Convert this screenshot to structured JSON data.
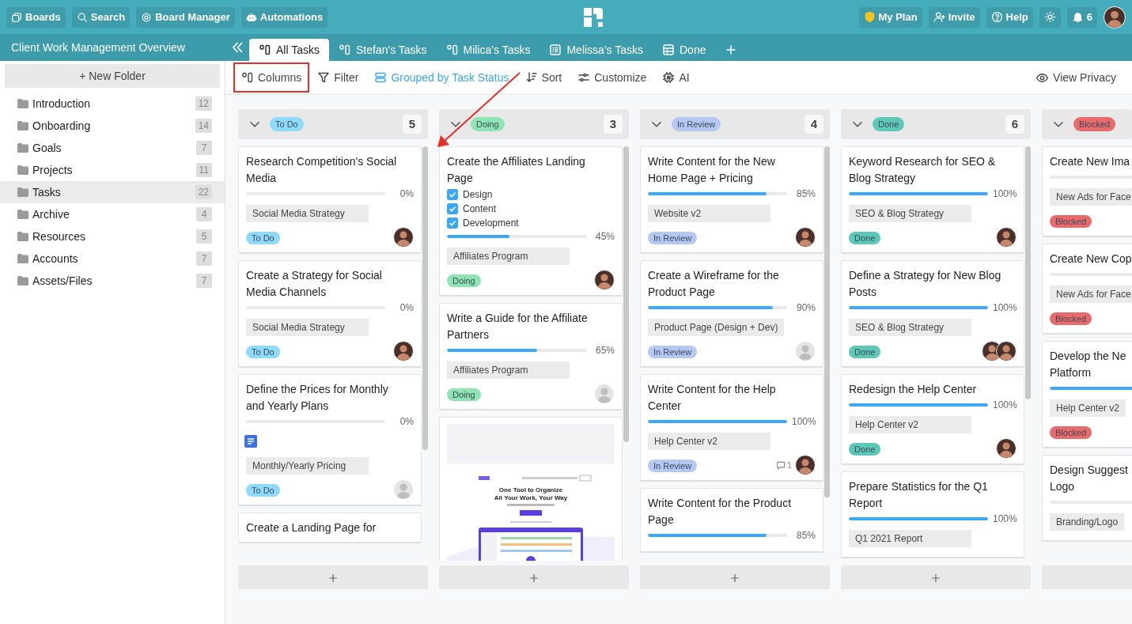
{
  "top_bar": {
    "left_buttons": [
      {
        "label": "Boards",
        "kind": "boards"
      },
      {
        "label": "Search",
        "kind": "search"
      },
      {
        "label": "Board Manager",
        "kind": "gear"
      },
      {
        "label": "Automations",
        "kind": "robot"
      }
    ],
    "right_buttons": [
      {
        "label": "My Plan",
        "kind": "shield"
      },
      {
        "label": "Invite",
        "kind": "user-plus"
      },
      {
        "label": "Help",
        "kind": "help"
      },
      {
        "kind": "sun"
      },
      {
        "label": "6",
        "kind": "bell"
      }
    ]
  },
  "project_title": "Client Work Management Overview",
  "tabs": [
    {
      "label": "All Tasks",
      "kind": "columns",
      "selected": true
    },
    {
      "label": "Stefan's Tasks",
      "kind": "columns",
      "selected": false
    },
    {
      "label": "Milica's Tasks",
      "kind": "columns",
      "selected": false
    },
    {
      "label": "Melissa's Tasks",
      "kind": "list",
      "selected": false
    },
    {
      "label": "Done",
      "kind": "table",
      "selected": false
    }
  ],
  "sidebar": {
    "new_folder": "+ New Folder",
    "items": [
      {
        "label": "Introduction",
        "count": "12",
        "selected": false
      },
      {
        "label": "Onboarding",
        "count": "14",
        "selected": false
      },
      {
        "label": "Goals",
        "count": "7",
        "selected": false
      },
      {
        "label": "Projects",
        "count": "11",
        "selected": false
      },
      {
        "label": "Tasks",
        "count": "22",
        "selected": true
      },
      {
        "label": "Archive",
        "count": "4",
        "selected": false
      },
      {
        "label": "Resources",
        "count": "5",
        "selected": false
      },
      {
        "label": "Accounts",
        "count": "7",
        "selected": false
      },
      {
        "label": "Assets/Files",
        "count": "7",
        "selected": false
      }
    ]
  },
  "toolbar": {
    "items": [
      {
        "label": "Columns",
        "kind": "columns",
        "active": false,
        "highlighted": true
      },
      {
        "label": "Filter",
        "kind": "filter",
        "active": false,
        "highlighted": false
      },
      {
        "label": "Grouped by Task Status",
        "kind": "rows",
        "active": true,
        "highlighted": false
      },
      {
        "label": "Sort",
        "kind": "sort",
        "active": false,
        "highlighted": false
      },
      {
        "label": "Customize",
        "kind": "sliders",
        "active": false,
        "highlighted": false
      },
      {
        "label": "AI",
        "kind": "chip",
        "active": false,
        "highlighted": false
      }
    ],
    "view_privacy": "View Privacy"
  },
  "annotations": [
    {
      "kind": "arrow"
    }
  ],
  "columns": [
    {
      "status": "To Do",
      "color": "#8fd9fb",
      "count": "5",
      "cards": [
        {
          "kind": "task",
          "title": "Research Competition's Social Media",
          "level": 0,
          "percent": "0%",
          "tag": "Social Media Strategy",
          "status": "To Do",
          "avatars": [
            {
              "kind": "photo"
            }
          ]
        },
        {
          "kind": "task",
          "title": "Create a Strategy for Social Media Channels",
          "level": 0,
          "percent": "0%",
          "tag": "Social Media Strategy",
          "status": "To Do",
          "avatars": [
            {
              "kind": "photo"
            }
          ]
        },
        {
          "kind": "task",
          "title": "Define the Prices for Monthly and Yearly Plans",
          "level": 0,
          "percent": "0%",
          "has_document": true,
          "tag": "Monthly/Yearly Pricing",
          "status": "To Do",
          "avatars": [
            {
              "kind": "placeholder"
            }
          ]
        },
        {
          "kind": "task",
          "title": "Create a Landing Page for"
        }
      ]
    },
    {
      "status": "Doing",
      "color": "#8ee4b4",
      "count": "3",
      "cards": [
        {
          "kind": "task",
          "title": "Create the Affiliates Landing Page",
          "checklist": [
            {
              "label": "Design",
              "checked": true
            },
            {
              "label": "Content",
              "checked": true
            },
            {
              "label": "Development",
              "checked": true
            }
          ],
          "level": 0.45,
          "percent": "45%",
          "tag": "Affiliates Program",
          "status": "Doing",
          "avatars": [
            {
              "kind": "photo"
            }
          ]
        },
        {
          "kind": "task",
          "title": "Write a Guide for the Affiliate Partners",
          "level": 0.65,
          "percent": "65%",
          "tag": "Affiliates Program",
          "status": "Doing",
          "avatars": [
            {
              "kind": "placeholder"
            }
          ]
        },
        {
          "kind": "preview",
          "headline": "One Tool to Organize\nAll Your Work, Your Way"
        }
      ]
    },
    {
      "status": "In Review",
      "color": "#b5c8f4",
      "count": "4",
      "cards": [
        {
          "kind": "task",
          "title": "Write Content for the New Home Page + Pricing",
          "level": 0.85,
          "percent": "85%",
          "tag": "Website v2",
          "status": "In Review",
          "avatars": [
            {
              "kind": "photo"
            }
          ]
        },
        {
          "kind": "task",
          "title": "Create a Wireframe for the Product Page",
          "level": 0.9,
          "percent": "90%",
          "tag": "Product Page (Design + Dev)",
          "status": "In Review",
          "avatars": [
            {
              "kind": "placeholder"
            }
          ]
        },
        {
          "kind": "task",
          "title": "Write Content for the Help Center",
          "level": 1,
          "percent": "100%",
          "tag": "Help Center v2",
          "status": "In Review",
          "comments": "1",
          "avatars": [
            {
              "kind": "photo"
            }
          ]
        },
        {
          "kind": "task",
          "title": "Write Content for the Product Page",
          "level": 0.85,
          "percent": "85%"
        }
      ]
    },
    {
      "status": "Done",
      "color": "#5ec8b6",
      "count": "6",
      "cards": [
        {
          "kind": "task",
          "title": "Keyword Research for SEO & Blog Strategy",
          "level": 1,
          "percent": "100%",
          "tag": "SEO & Blog Strategy",
          "status": "Done",
          "avatars": [
            {
              "kind": "photo"
            }
          ]
        },
        {
          "kind": "task",
          "title": "Define a Strategy for New Blog Posts",
          "level": 1,
          "percent": "100%",
          "tag": "SEO & Blog Strategy",
          "status": "Done",
          "avatars": [
            {
              "kind": "photo"
            },
            {
              "kind": "photo"
            }
          ]
        },
        {
          "kind": "task",
          "title": "Redesign the Help Center",
          "level": 1,
          "percent": "100%",
          "tag": "Help Center v2",
          "status": "Done",
          "avatars": [
            {
              "kind": "photo"
            }
          ]
        },
        {
          "kind": "task",
          "title": "Prepare Statistics for the Q1 Report",
          "level": 1,
          "percent": "100%",
          "tag": "Q1 2021 Report"
        }
      ]
    },
    {
      "status": "Blocked",
      "color": "#e96a6a",
      "cards": [
        {
          "kind": "task",
          "title": "Create New Ima",
          "level": 0,
          "tag": "New Ads for Face",
          "status": "Blocked"
        },
        {
          "kind": "task",
          "title": "Create New Cop",
          "level": 0,
          "tag": "New Ads for Face",
          "status": "Blocked"
        },
        {
          "kind": "task",
          "title": "Develop the Ne\nPlatform",
          "level": 1,
          "tag": "Help Center v2",
          "status": "Blocked"
        },
        {
          "kind": "task",
          "title": "Design Suggest\nLogo",
          "level": 0,
          "tag": "Branding/Logo"
        }
      ]
    }
  ]
}
